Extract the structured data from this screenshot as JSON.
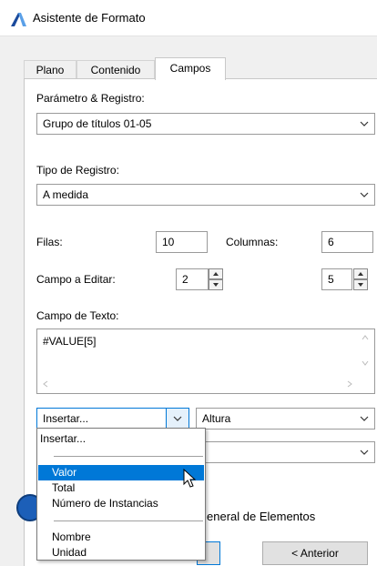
{
  "window": {
    "title": "Asistente de Formato"
  },
  "tabs": [
    {
      "label": "Plano"
    },
    {
      "label": "Contenido"
    },
    {
      "label": "Campos"
    }
  ],
  "fields": {
    "parametro_label": "Parámetro & Registro:",
    "parametro_value": "Grupo de títulos 01-05",
    "tipo_label": "Tipo de Registro:",
    "tipo_value": "A medida",
    "filas_label": "Filas:",
    "filas_value": "10",
    "columnas_label": "Columnas:",
    "columnas_value": "6",
    "campo_editar_label": "Campo a Editar:",
    "campo_editar_row": "2",
    "campo_editar_col": "5",
    "texto_label": "Campo de Texto:",
    "texto_value": "#VALUE[5]"
  },
  "insert_row": {
    "insert_value": "Insertar...",
    "property_value": "Altura"
  },
  "dropdown": {
    "items": [
      {
        "label": "Insertar..."
      },
      {
        "label": "Valor"
      },
      {
        "label": "Total"
      },
      {
        "label": "Número de Instancias"
      },
      {
        "label": "Nombre"
      },
      {
        "label": "Unidad"
      }
    ],
    "selected": "Valor"
  },
  "bottom": {
    "partial_label": "eneral de Elementos",
    "prev_button": "< Anterior"
  },
  "colors": {
    "selection": "#0078d7",
    "accent_icon": "#1a4a9c"
  }
}
